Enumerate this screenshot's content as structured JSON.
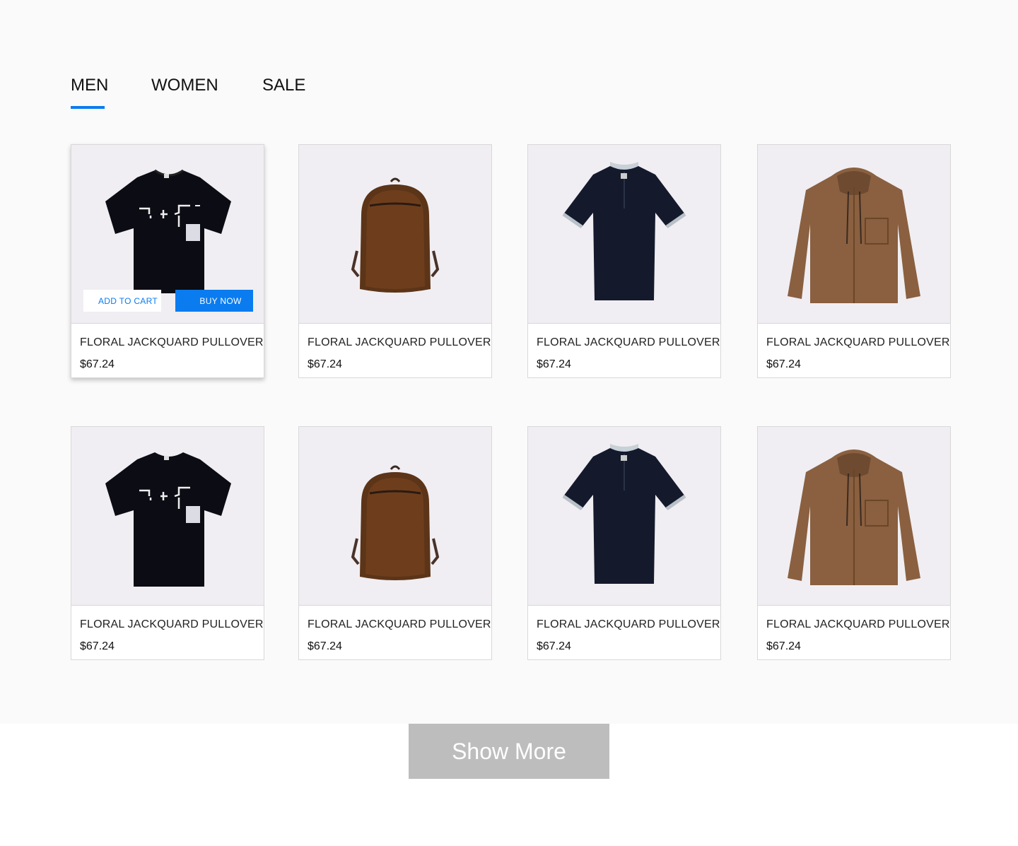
{
  "tabs": [
    {
      "label": "MEN",
      "active": true
    },
    {
      "label": "WOMEN",
      "active": false
    },
    {
      "label": "SALE",
      "active": false
    }
  ],
  "colors": {
    "accent": "#0a7cf0",
    "image_bg": "#f0eef2",
    "show_more_bg": "#bdbdbd"
  },
  "actions": {
    "add_to_cart": "ADD TO CART",
    "buy_now": "BUY NOW"
  },
  "products": [
    {
      "title": "FLORAL JACKQUARD PULLOVER",
      "price": "$67.24",
      "image": "black-tshirt-icon"
    },
    {
      "title": "FLORAL JACKQUARD PULLOVER",
      "price": "$67.24",
      "image": "brown-backpack-icon"
    },
    {
      "title": "FLORAL JACKQUARD PULLOVER",
      "price": "$67.24",
      "image": "navy-polo-icon"
    },
    {
      "title": "FLORAL JACKQUARD PULLOVER",
      "price": "$67.24",
      "image": "brown-hooded-shirt-icon"
    },
    {
      "title": "FLORAL JACKQUARD PULLOVER",
      "price": "$67.24",
      "image": "black-tshirt-icon"
    },
    {
      "title": "FLORAL JACKQUARD PULLOVER",
      "price": "$67.24",
      "image": "brown-backpack-icon"
    },
    {
      "title": "FLORAL JACKQUARD PULLOVER",
      "price": "$67.24",
      "image": "navy-polo-icon"
    },
    {
      "title": "FLORAL JACKQUARD PULLOVER",
      "price": "$67.24",
      "image": "brown-hooded-shirt-icon"
    }
  ],
  "show_more": "Show More"
}
